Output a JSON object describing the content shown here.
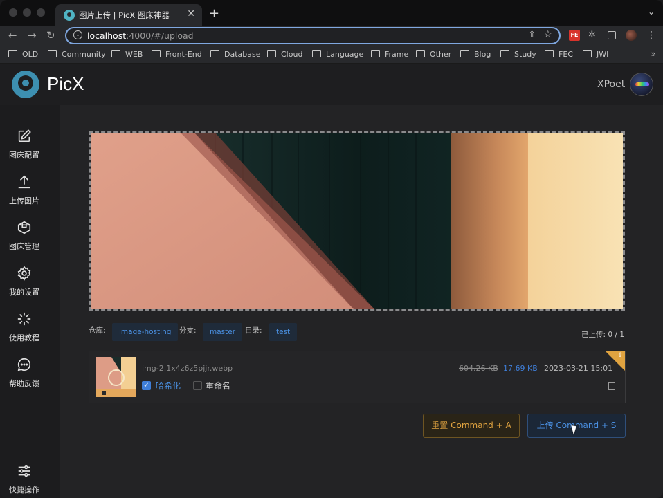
{
  "browser": {
    "tab_title": "图片上传 | PicX 图床神器",
    "tab_close": "✕",
    "new_tab": "+",
    "tab_menu": "⌄",
    "url_host": "localhost",
    "url_path": ":4000/#/upload",
    "nav_back": "←",
    "nav_forward": "→",
    "nav_reload": "↻",
    "share_glyph": "⇧",
    "star_glyph": "☆",
    "ext_fe": "FE",
    "ext_puzzle": "✲",
    "menu_glyph": "⋮",
    "bookmarks": [
      "OLD",
      "Community",
      "WEB",
      "Front-End",
      "Database",
      "Cloud",
      "Language",
      "Frame",
      "Other",
      "Blog",
      "Study",
      "FEC",
      "JWI"
    ],
    "bookmarks_more": "»"
  },
  "app": {
    "logo_text": "PicX",
    "username": "XPoet"
  },
  "sidebar": {
    "items": [
      {
        "label": "图床配置",
        "icon": "edit-icon"
      },
      {
        "label": "上传图片",
        "icon": "upload-icon"
      },
      {
        "label": "图床管理",
        "icon": "box-icon"
      },
      {
        "label": "我的设置",
        "icon": "gear-icon"
      },
      {
        "label": "使用教程",
        "icon": "sparkle-icon"
      },
      {
        "label": "帮助反馈",
        "icon": "chat-icon"
      },
      {
        "label": "快捷操作",
        "icon": "sliders-icon"
      }
    ]
  },
  "repo": {
    "repo_label": "仓库:",
    "repo_value": "image-hosting",
    "branch_label": "分支:",
    "branch_value": "master",
    "dir_label": "目录:",
    "dir_value": "test",
    "uploaded": "已上传: 0 / 1"
  },
  "file": {
    "name": "img-2.1x4z6z5pjjr.webp",
    "original_size": "604.26 KB",
    "compressed_size": "17.69 KB",
    "date": "2023-03-21 15:01",
    "hash_checked": true,
    "hash_label": "哈希化",
    "rename_checked": false,
    "rename_label": "重命名",
    "check_glyph": "✓",
    "corner_glyph": "⇪"
  },
  "actions": {
    "reset_label": "重置 Command + A",
    "upload_label": "上传 Command + S"
  },
  "colors": {
    "accent_blue": "#4a8fe0",
    "accent_orange": "#e0a340",
    "background": "#232325"
  }
}
